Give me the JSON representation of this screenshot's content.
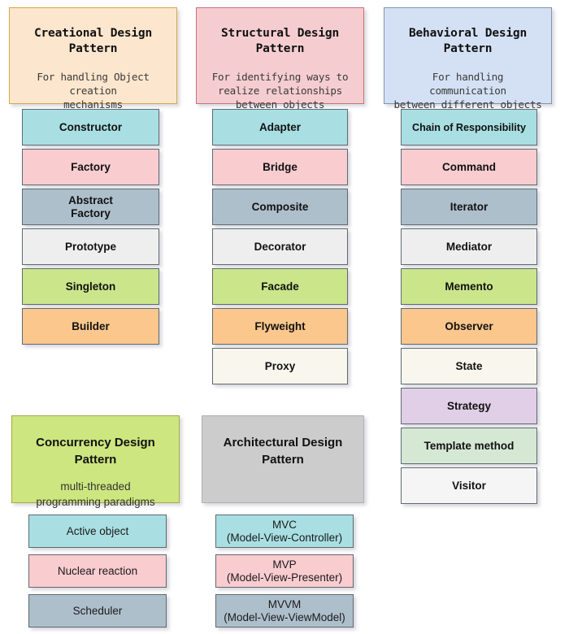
{
  "diagram": {
    "title": "Design Patterns Overview",
    "colors": {
      "cyan": "#a9dfe3",
      "pink": "#f9ccd0",
      "blue_gray": "#aebfcc",
      "light_gray": "#eeeeee",
      "green": "#cbe58a",
      "orange": "#fbc78d",
      "ivory": "#f9f7ed",
      "purple": "#e1cfe7",
      "pale_green": "#d5e8d4",
      "white": "#f5f5f5",
      "creational_header": "#fce6cd",
      "structural_header": "#f5cdd0",
      "behavioral_header": "#d4e1f5",
      "concurrency_header": "#cde67f",
      "architectural_header": "#cccccc",
      "header_border": "#b89a3c",
      "box_border": "#5d6a72"
    }
  },
  "categories": [
    {
      "id": "creational",
      "title": "Creational Design\nPattern",
      "subtitle": "For handling Object creation\nmechanisms",
      "bg": "#fce6cd",
      "border": "#d6a84a",
      "font": "mono",
      "patterns": [
        {
          "label": "Constructor",
          "bg": "#a9dfe3",
          "lines": 1
        },
        {
          "label": "Factory",
          "bg": "#f9ccd0",
          "lines": 1
        },
        {
          "label": "Abstract\nFactory",
          "bg": "#aebfcc",
          "lines": 2
        },
        {
          "label": "Prototype",
          "bg": "#eeeeee",
          "lines": 1
        },
        {
          "label": "Singleton",
          "bg": "#cbe58a",
          "lines": 1
        },
        {
          "label": "Builder",
          "bg": "#fbc78d",
          "lines": 1
        }
      ]
    },
    {
      "id": "structural",
      "title": "Structural Design\nPattern",
      "subtitle": "For identifying ways to\nrealize relationships\nbetween objects",
      "bg": "#f5cdd0",
      "border": "#c2737a",
      "font": "mono",
      "patterns": [
        {
          "label": "Adapter",
          "bg": "#a9dfe3",
          "lines": 1
        },
        {
          "label": "Bridge",
          "bg": "#f9ccd0",
          "lines": 1
        },
        {
          "label": "Composite",
          "bg": "#aebfcc",
          "lines": 1
        },
        {
          "label": "Decorator",
          "bg": "#eeeeee",
          "lines": 1
        },
        {
          "label": "Facade",
          "bg": "#cbe58a",
          "lines": 1
        },
        {
          "label": "Flyweight",
          "bg": "#fbc78d",
          "lines": 1
        },
        {
          "label": "Proxy",
          "bg": "#f9f7ed",
          "lines": 1
        }
      ]
    },
    {
      "id": "behavioral",
      "title": "Behavioral Design\nPattern",
      "subtitle": "For handling communication\nbetween different objects",
      "bg": "#d4e1f5",
      "border": "#7f93b5",
      "font": "mono",
      "patterns": [
        {
          "label": "Chain of Responsibility",
          "bg": "#a9dfe3",
          "lines": 1,
          "small": true
        },
        {
          "label": "Command",
          "bg": "#f9ccd0",
          "lines": 1
        },
        {
          "label": "Iterator",
          "bg": "#aebfcc",
          "lines": 1
        },
        {
          "label": "Mediator",
          "bg": "#eeeeee",
          "lines": 1
        },
        {
          "label": "Memento",
          "bg": "#cbe58a",
          "lines": 1
        },
        {
          "label": "Observer",
          "bg": "#fbc78d",
          "lines": 1
        },
        {
          "label": "State",
          "bg": "#f9f7ed",
          "lines": 1
        },
        {
          "label": "Strategy",
          "bg": "#e1cfe7",
          "lines": 1
        },
        {
          "label": "Template method",
          "bg": "#d5e8d4",
          "lines": 1
        },
        {
          "label": "Visitor",
          "bg": "#f5f5f5",
          "lines": 1
        }
      ]
    },
    {
      "id": "concurrency",
      "title": "Concurrency Design\nPattern",
      "subtitle": "multi-threaded\nprogramming paradigms",
      "bg": "#cde67f",
      "border": "#a3ab48",
      "font": "sans",
      "patterns": [
        {
          "label": "Active object",
          "bg": "#a9dfe3",
          "lines": 1,
          "regular": true
        },
        {
          "label": "Nuclear reaction",
          "bg": "#f9ccd0",
          "lines": 1,
          "regular": true
        },
        {
          "label": "Scheduler",
          "bg": "#aebfcc",
          "lines": 1,
          "regular": true
        }
      ]
    },
    {
      "id": "architectural",
      "title": "Architectural Design\nPattern",
      "subtitle": "",
      "bg": "#cccccc",
      "border": "#b0b0b0",
      "font": "sans",
      "patterns": [
        {
          "label": "MVC\n(Model-View-Controller)",
          "bg": "#a9dfe3",
          "lines": 2,
          "regular": true
        },
        {
          "label": "MVP\n(Model-View-Presenter)",
          "bg": "#f9ccd0",
          "lines": 2,
          "regular": true
        },
        {
          "label": "MVVM\n(Model-View-ViewModel)",
          "bg": "#aebfcc",
          "lines": 2,
          "regular": true
        }
      ]
    }
  ]
}
